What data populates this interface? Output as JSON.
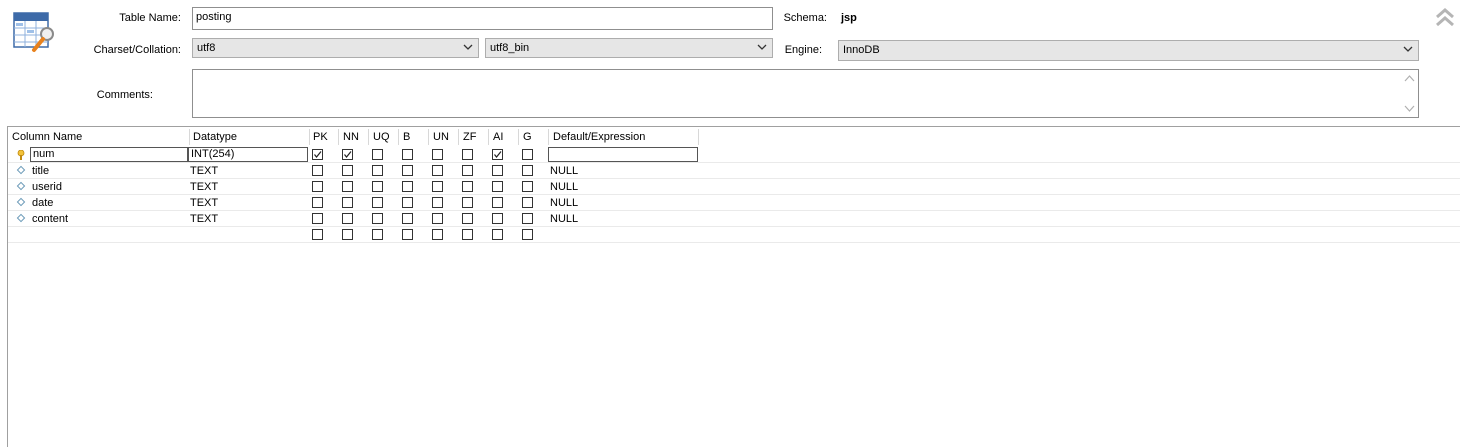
{
  "form": {
    "table_name_label": "Table Name:",
    "table_name_value": "posting",
    "schema_label": "Schema:",
    "schema_value": "jsp",
    "charset_label": "Charset/Collation:",
    "charset_value": "utf8",
    "collation_value": "utf8_bin",
    "engine_label": "Engine:",
    "engine_value": "InnoDB",
    "comments_label": "Comments:",
    "comments_value": ""
  },
  "grid": {
    "headers": {
      "column_name": "Column Name",
      "datatype": "Datatype",
      "pk": "PK",
      "nn": "NN",
      "uq": "UQ",
      "b": "B",
      "un": "UN",
      "zf": "ZF",
      "ai": "AI",
      "g": "G",
      "default": "Default/Expression"
    },
    "rows": [
      {
        "name": "num",
        "type": "INT(254)",
        "default": "",
        "pk": true,
        "nn": true,
        "ai": true
      },
      {
        "name": "title",
        "type": "TEXT",
        "default": "NULL"
      },
      {
        "name": "userid",
        "type": "TEXT",
        "default": "NULL"
      },
      {
        "name": "date",
        "type": "TEXT",
        "default": "NULL"
      },
      {
        "name": "content",
        "type": "TEXT",
        "default": "NULL"
      }
    ]
  },
  "icons": {
    "table_icon": "table-settings-icon",
    "collapse_icon": "double-chevron-up-icon",
    "key_icon": "primary-key-icon",
    "column_icon": "column-diamond-icon"
  }
}
